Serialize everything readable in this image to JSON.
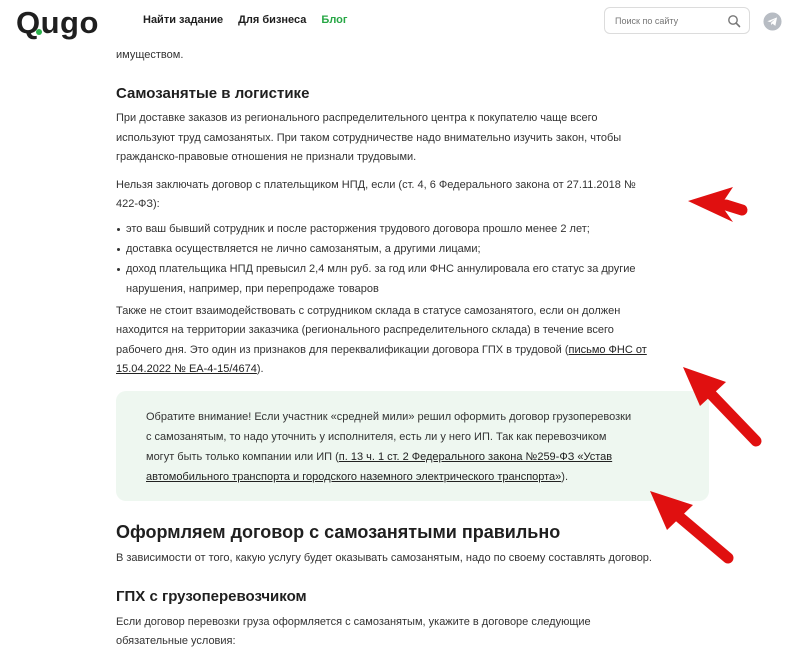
{
  "header": {
    "logo": "Qugo",
    "nav": [
      {
        "label": "Найти задание"
      },
      {
        "label": "Для бизнеса"
      },
      {
        "label": "Блог"
      }
    ],
    "search_placeholder": "Поиск по сайту"
  },
  "article": {
    "intro_tail": "имуществом.",
    "section1_title": "Самозанятые в логистике",
    "p1_l1": "При доставке заказов из регионального распределительного центра к покупателю чаще всего",
    "p1_l2": "используют труд самозанятых. При таком сотрудничестве надо внимательно изучить закон, чтобы",
    "p1_l3": "гражданско-правовые отношения не признали трудовыми.",
    "p2_l1": "Нельзя заключать договор с плательщиком НПД, если (ст. 4, 6 Федерального закона от 27.11.2018 №",
    "p2_l2": "422-ФЗ):",
    "bullets": [
      "это ваш бывший сотрудник и после расторжения трудового договора прошло менее 2 лет;",
      "доставка осуществляется не лично самозанятым, а другими лицами;",
      "доход плательщика НПД превысил 2,4 млн руб. за год или ФНС аннулировала его статус за другие",
      "нарушения, например, при перепродаже товаров"
    ],
    "p3_l1": "Также не стоит взаимодействовать с сотрудником склада в статусе самозанятого, если он должен",
    "p3_l2": "находится на территории заказчика (регионального распределительного склада) в течение всего",
    "p3_l3a": "рабочего дня. Это один из признаков для переквалификации договора ГПХ в трудовой (",
    "p3_link_a": "письмо ФНС от",
    "p3_link_b": "15.04.2022 № ЕА-4-15/4674",
    "p3_l4_tail": ").",
    "note_l1": "Обратите внимание! Если участник «средней мили» решил оформить договор грузоперевозки",
    "note_l2": "с самозанятым, то надо уточнить у исполнителя, есть ли у него ИП. Так как перевозчиком",
    "note_l3a": "могут быть только компании или ИП (",
    "note_link_a": "п. 13 ч. 1 ст. 2 Федерального закона №259-ФЗ «Устав",
    "note_link_b": "автомобильного транспорта и городского наземного электрического транспорта»",
    "note_l4_tail": ").",
    "section2_title": "Оформляем договор с самозанятыми правильно",
    "p4": "В зависимости от того, какую услугу будет оказывать самозанятым, надо по своему составлять договор.",
    "section3_title": "ГПХ с грузоперевозчиком",
    "p5_l1": "Если договор перевозки груза оформляется с самозанятым, укажите в договоре следующие",
    "p5_l2": "обязательные условия:"
  },
  "colors": {
    "accent": "#27a745",
    "note_bg": "#eef7f0",
    "arrow": "#e01010"
  },
  "icons": [
    "search-icon",
    "telegram-icon",
    "arrow-annotation"
  ]
}
